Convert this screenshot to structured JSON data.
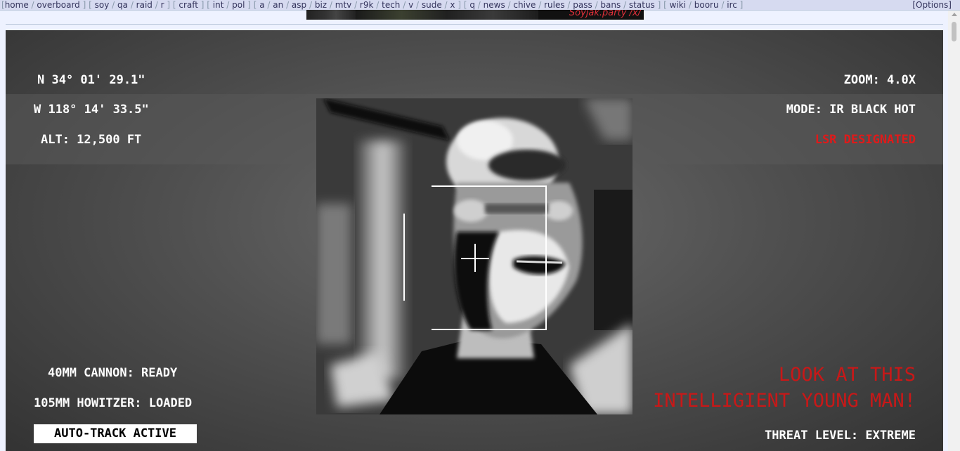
{
  "nav": {
    "groups": [
      [
        "home",
        "overboard"
      ],
      [
        "soy",
        "qa",
        "raid",
        "r"
      ],
      [
        "craft"
      ],
      [
        "int",
        "pol"
      ],
      [
        "a",
        "an",
        "asp",
        "biz",
        "mtv",
        "r9k",
        "tech",
        "v",
        "sude",
        "x"
      ],
      [
        "q",
        "news",
        "chive",
        "rules",
        "pass",
        "bans",
        "status"
      ],
      [
        "wiki",
        "booru",
        "irc"
      ]
    ],
    "options_label": "[Options]"
  },
  "banner": {
    "text": "Soyjak.party /x/"
  },
  "hud": {
    "lat": "N 34° 01' 29.1\"",
    "lon": "W 118° 14' 33.5\"",
    "alt": "ALT: 12,500 FT",
    "zoom": "ZOOM: 4.0X",
    "mode": "MODE: IR BLACK HOT",
    "laser": "LSR DESIGNATED",
    "cannon": "40MM CANNON: READY",
    "howitzer": "105MM HOWITZER: LOADED",
    "autotrack": "AUTO-TRACK ACTIVE",
    "message_line1": "LOOK AT THIS",
    "message_line2": "INTELLIGIENT YOUNG MAN!",
    "threat": "THREAT LEVEL: EXTREME",
    "colors": {
      "laser": "#e01a1a",
      "message": "#c81818"
    }
  }
}
